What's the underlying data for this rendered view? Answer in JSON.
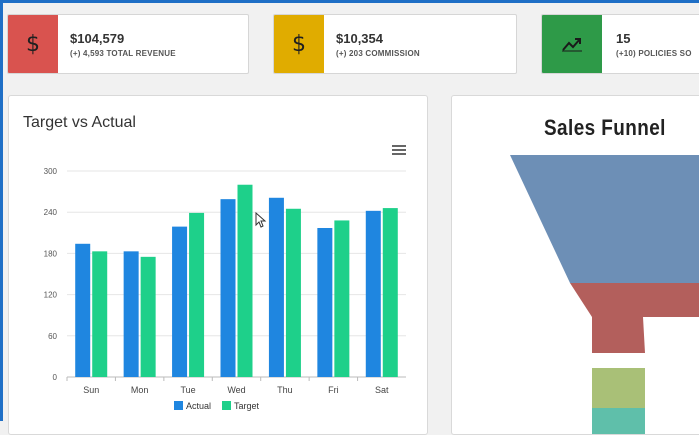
{
  "stats": [
    {
      "value": "$104,579",
      "label": "(+) 4,593 TOTAL REVENUE",
      "icon": "dollar-icon",
      "glyph": "$",
      "color": "#d9534f"
    },
    {
      "value": "$10,354",
      "label": "(+) 203 COMMISSION",
      "icon": "dollar-icon",
      "glyph": "$",
      "color": "#e0ac00"
    },
    {
      "value": "15",
      "label": "(+10) POLICIES SO",
      "icon": "trending-up-icon",
      "glyph": "",
      "color": "#2e9a48"
    }
  ],
  "target_panel": {
    "title": "Target vs Actual"
  },
  "funnel_panel": {
    "title": "Sales Funnel"
  },
  "funnel_colors": [
    "#6d8fb6",
    "#b35f5c",
    "#a9c077",
    "#5fbfaa"
  ],
  "chart_data": {
    "type": "bar",
    "categories": [
      "Sun",
      "Mon",
      "Tue",
      "Wed",
      "Thu",
      "Fri",
      "Sat"
    ],
    "series": [
      {
        "name": "Actual",
        "values": [
          194,
          183,
          219,
          259,
          261,
          217,
          242
        ],
        "color": "#1f86e0"
      },
      {
        "name": "Target",
        "values": [
          183,
          175,
          239,
          280,
          245,
          228,
          246
        ],
        "color": "#1ed08a"
      }
    ],
    "yticks": [
      0,
      60,
      120,
      180,
      240,
      300
    ],
    "ylim": [
      0,
      300
    ],
    "grid": true,
    "legend": "bottom"
  }
}
